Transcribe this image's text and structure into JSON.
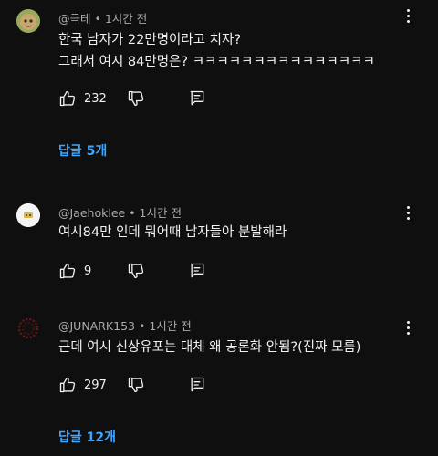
{
  "comments": [
    {
      "author": "@극테",
      "time": "1시간 전",
      "lines": [
        "한국 남자가 22만명이라고 치자?",
        "그래서 여시 84만명은?  ㅋㅋㅋㅋㅋㅋㅋㅋㅋㅋㅋㅋㅋㅋㅋ"
      ],
      "likes": "232",
      "replies": "답글 5개"
    },
    {
      "author": "@Jaehoklee",
      "time": "1시간 전",
      "lines": [
        "여시84만 인데 뭐어때  남자들아 분발해라"
      ],
      "likes": "9",
      "replies": ""
    },
    {
      "author": "@JUNARK153",
      "time": "1시간 전",
      "lines": [
        "근데 여시 신상유포는 대체 왜 공론화 안됨?(진짜 모름)"
      ],
      "likes": "297",
      "replies": "답글 12개"
    }
  ],
  "separator": "•",
  "colors": {
    "background": "#0f0f0f",
    "text": "#f1f1f1",
    "meta": "#aaaaaa",
    "link": "#3ea6ff"
  },
  "icons": [
    "thumbs-up-icon",
    "thumbs-down-icon",
    "reply-icon",
    "more-vert-icon"
  ]
}
